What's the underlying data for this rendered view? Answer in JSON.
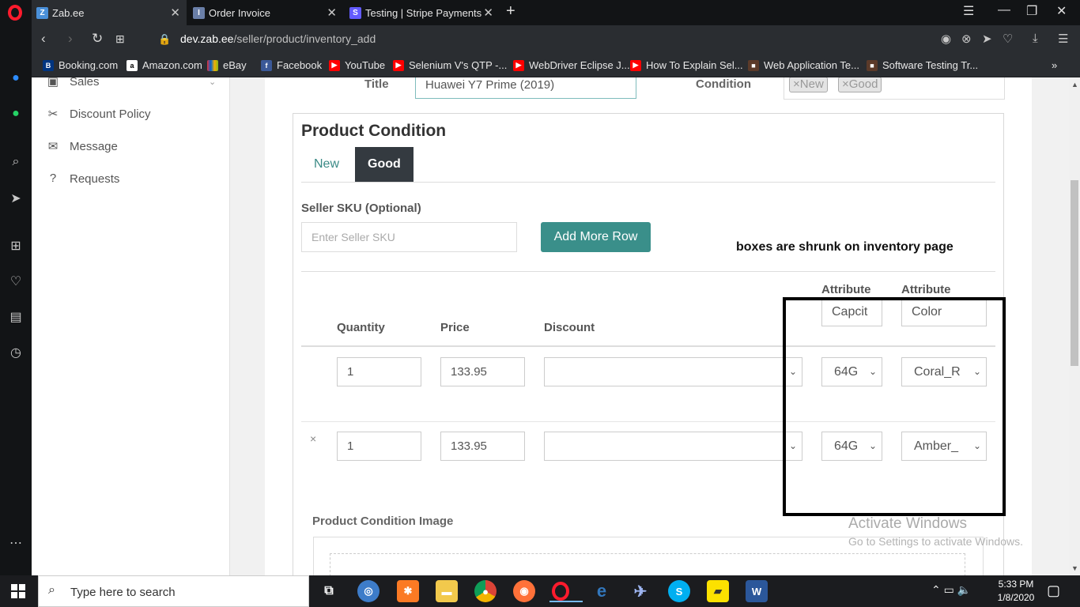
{
  "browser": {
    "tabs": [
      {
        "title": "Zab.ee",
        "icon": "zabee-favicon",
        "active": true
      },
      {
        "title": "Order Invoice",
        "icon": "invoice-favicon",
        "active": false
      },
      {
        "title": "Testing | Stripe Payments",
        "icon": "stripe-favicon",
        "active": false
      }
    ],
    "url_host": "dev.zab.ee",
    "url_path": "/seller/product/inventory_add",
    "bookmarks": [
      {
        "label": "Booking.com",
        "icon": "booking-icon"
      },
      {
        "label": "Amazon.com",
        "icon": "amazon-icon"
      },
      {
        "label": "eBay",
        "icon": "ebay-icon"
      },
      {
        "label": "Facebook",
        "icon": "facebook-icon"
      },
      {
        "label": "YouTube",
        "icon": "youtube-icon"
      },
      {
        "label": "Selenium V's QTP -...",
        "icon": "youtube-icon"
      },
      {
        "label": "WebDriver Eclipse J...",
        "icon": "youtube-icon"
      },
      {
        "label": "How To Explain Sel...",
        "icon": "youtube-icon"
      },
      {
        "label": "Web Application Te...",
        "icon": "cube-icon"
      },
      {
        "label": "Software Testing Tr...",
        "icon": "cube-icon"
      }
    ]
  },
  "sidebar_nav": {
    "items": [
      {
        "label": "Sales",
        "icon": "briefcase-icon"
      },
      {
        "label": "Discount Policy",
        "icon": "scissors-icon"
      },
      {
        "label": "Message",
        "icon": "envelope-icon"
      },
      {
        "label": "Requests",
        "icon": "question-icon"
      }
    ]
  },
  "product": {
    "title_label": "Title",
    "title_value": "Huawei Y7 Prime (2019)",
    "condition_label": "Condition",
    "condition_chips": [
      "New",
      "Good"
    ]
  },
  "condition_panel": {
    "heading": "Product Condition",
    "tabs": [
      "New",
      "Good"
    ],
    "active_tab": "Good",
    "sku_label": "Seller SKU (Optional)",
    "sku_placeholder": "Enter Seller SKU",
    "add_row_label": "Add More Row",
    "columns": [
      "Quantity",
      "Price",
      "Discount"
    ],
    "attribute_headers": [
      "Attribute",
      "Attribute"
    ],
    "attribute_names": [
      "Capcit",
      "Color"
    ],
    "rows": [
      {
        "quantity": "1",
        "price": "133.95",
        "discount": "",
        "capacity": "64G",
        "color": "Coral_R",
        "removable": false
      },
      {
        "quantity": "1",
        "price": "133.95",
        "discount": "",
        "capacity": "64G",
        "color": "Amber_",
        "removable": true
      }
    ],
    "image_label": "Product Condition Image"
  },
  "annotation": {
    "text": "boxes are shrunk on inventory page"
  },
  "watermark": {
    "title": "Activate Windows",
    "subtitle": "Go to Settings to activate Windows."
  },
  "taskbar": {
    "search_placeholder": "Type here to search",
    "time": "5:33 PM",
    "date": "1/8/2020"
  }
}
